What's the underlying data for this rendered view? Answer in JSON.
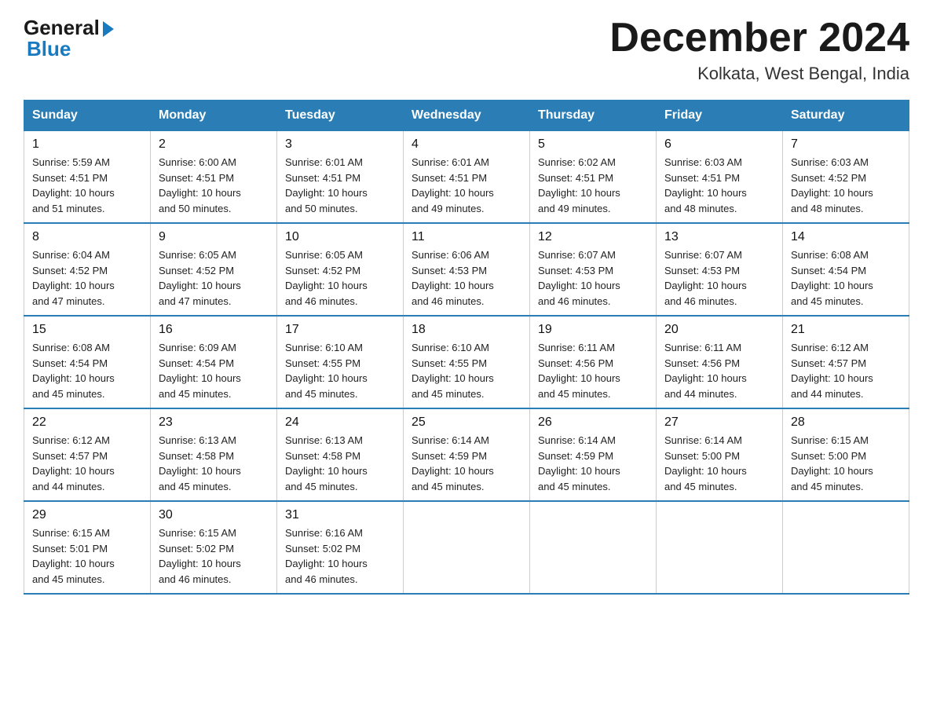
{
  "logo": {
    "general": "General",
    "blue": "Blue"
  },
  "header": {
    "month_year": "December 2024",
    "location": "Kolkata, West Bengal, India"
  },
  "days_of_week": [
    "Sunday",
    "Monday",
    "Tuesday",
    "Wednesday",
    "Thursday",
    "Friday",
    "Saturday"
  ],
  "weeks": [
    [
      {
        "day": "1",
        "info": "Sunrise: 5:59 AM\nSunset: 4:51 PM\nDaylight: 10 hours\nand 51 minutes."
      },
      {
        "day": "2",
        "info": "Sunrise: 6:00 AM\nSunset: 4:51 PM\nDaylight: 10 hours\nand 50 minutes."
      },
      {
        "day": "3",
        "info": "Sunrise: 6:01 AM\nSunset: 4:51 PM\nDaylight: 10 hours\nand 50 minutes."
      },
      {
        "day": "4",
        "info": "Sunrise: 6:01 AM\nSunset: 4:51 PM\nDaylight: 10 hours\nand 49 minutes."
      },
      {
        "day": "5",
        "info": "Sunrise: 6:02 AM\nSunset: 4:51 PM\nDaylight: 10 hours\nand 49 minutes."
      },
      {
        "day": "6",
        "info": "Sunrise: 6:03 AM\nSunset: 4:51 PM\nDaylight: 10 hours\nand 48 minutes."
      },
      {
        "day": "7",
        "info": "Sunrise: 6:03 AM\nSunset: 4:52 PM\nDaylight: 10 hours\nand 48 minutes."
      }
    ],
    [
      {
        "day": "8",
        "info": "Sunrise: 6:04 AM\nSunset: 4:52 PM\nDaylight: 10 hours\nand 47 minutes."
      },
      {
        "day": "9",
        "info": "Sunrise: 6:05 AM\nSunset: 4:52 PM\nDaylight: 10 hours\nand 47 minutes."
      },
      {
        "day": "10",
        "info": "Sunrise: 6:05 AM\nSunset: 4:52 PM\nDaylight: 10 hours\nand 46 minutes."
      },
      {
        "day": "11",
        "info": "Sunrise: 6:06 AM\nSunset: 4:53 PM\nDaylight: 10 hours\nand 46 minutes."
      },
      {
        "day": "12",
        "info": "Sunrise: 6:07 AM\nSunset: 4:53 PM\nDaylight: 10 hours\nand 46 minutes."
      },
      {
        "day": "13",
        "info": "Sunrise: 6:07 AM\nSunset: 4:53 PM\nDaylight: 10 hours\nand 46 minutes."
      },
      {
        "day": "14",
        "info": "Sunrise: 6:08 AM\nSunset: 4:54 PM\nDaylight: 10 hours\nand 45 minutes."
      }
    ],
    [
      {
        "day": "15",
        "info": "Sunrise: 6:08 AM\nSunset: 4:54 PM\nDaylight: 10 hours\nand 45 minutes."
      },
      {
        "day": "16",
        "info": "Sunrise: 6:09 AM\nSunset: 4:54 PM\nDaylight: 10 hours\nand 45 minutes."
      },
      {
        "day": "17",
        "info": "Sunrise: 6:10 AM\nSunset: 4:55 PM\nDaylight: 10 hours\nand 45 minutes."
      },
      {
        "day": "18",
        "info": "Sunrise: 6:10 AM\nSunset: 4:55 PM\nDaylight: 10 hours\nand 45 minutes."
      },
      {
        "day": "19",
        "info": "Sunrise: 6:11 AM\nSunset: 4:56 PM\nDaylight: 10 hours\nand 45 minutes."
      },
      {
        "day": "20",
        "info": "Sunrise: 6:11 AM\nSunset: 4:56 PM\nDaylight: 10 hours\nand 44 minutes."
      },
      {
        "day": "21",
        "info": "Sunrise: 6:12 AM\nSunset: 4:57 PM\nDaylight: 10 hours\nand 44 minutes."
      }
    ],
    [
      {
        "day": "22",
        "info": "Sunrise: 6:12 AM\nSunset: 4:57 PM\nDaylight: 10 hours\nand 44 minutes."
      },
      {
        "day": "23",
        "info": "Sunrise: 6:13 AM\nSunset: 4:58 PM\nDaylight: 10 hours\nand 45 minutes."
      },
      {
        "day": "24",
        "info": "Sunrise: 6:13 AM\nSunset: 4:58 PM\nDaylight: 10 hours\nand 45 minutes."
      },
      {
        "day": "25",
        "info": "Sunrise: 6:14 AM\nSunset: 4:59 PM\nDaylight: 10 hours\nand 45 minutes."
      },
      {
        "day": "26",
        "info": "Sunrise: 6:14 AM\nSunset: 4:59 PM\nDaylight: 10 hours\nand 45 minutes."
      },
      {
        "day": "27",
        "info": "Sunrise: 6:14 AM\nSunset: 5:00 PM\nDaylight: 10 hours\nand 45 minutes."
      },
      {
        "day": "28",
        "info": "Sunrise: 6:15 AM\nSunset: 5:00 PM\nDaylight: 10 hours\nand 45 minutes."
      }
    ],
    [
      {
        "day": "29",
        "info": "Sunrise: 6:15 AM\nSunset: 5:01 PM\nDaylight: 10 hours\nand 45 minutes."
      },
      {
        "day": "30",
        "info": "Sunrise: 6:15 AM\nSunset: 5:02 PM\nDaylight: 10 hours\nand 46 minutes."
      },
      {
        "day": "31",
        "info": "Sunrise: 6:16 AM\nSunset: 5:02 PM\nDaylight: 10 hours\nand 46 minutes."
      },
      {
        "day": "",
        "info": ""
      },
      {
        "day": "",
        "info": ""
      },
      {
        "day": "",
        "info": ""
      },
      {
        "day": "",
        "info": ""
      }
    ]
  ]
}
